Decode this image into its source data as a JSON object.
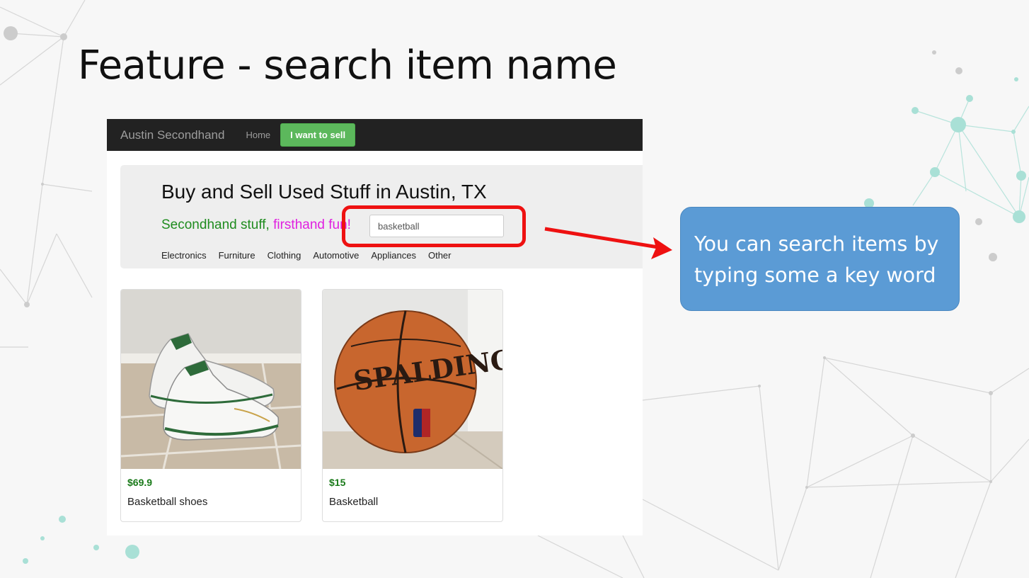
{
  "slide": {
    "title": "Feature - search item name"
  },
  "app": {
    "brand": "Austin Secondhand",
    "nav_home": "Home",
    "sell_button": "I want to sell",
    "headline": "Buy and Sell Used Stuff in Austin, TX",
    "tagline_green": "Secondhand stuff, ",
    "tagline_magenta": "firsthand fun!",
    "search": {
      "value": "basketball",
      "placeholder": ""
    },
    "categories": [
      "Electronics",
      "Furniture",
      "Clothing",
      "Automotive",
      "Appliances",
      "Other"
    ],
    "items": [
      {
        "price": "$69.9",
        "name": "Basketball shoes",
        "photo_icon": "sneakers-photo"
      },
      {
        "price": "$15",
        "name": "Basketball",
        "photo_icon": "basketball-photo"
      }
    ]
  },
  "callout": {
    "text": "You can search items by typing some a key word"
  },
  "colors": {
    "navbar": "#222222",
    "sell_button": "#5cb85c",
    "highlight": "#ee1111",
    "callout": "#5b9bd5",
    "price": "#1a7a1a",
    "tagline_green": "#1f8c1f",
    "tagline_magenta": "#e020e0"
  }
}
